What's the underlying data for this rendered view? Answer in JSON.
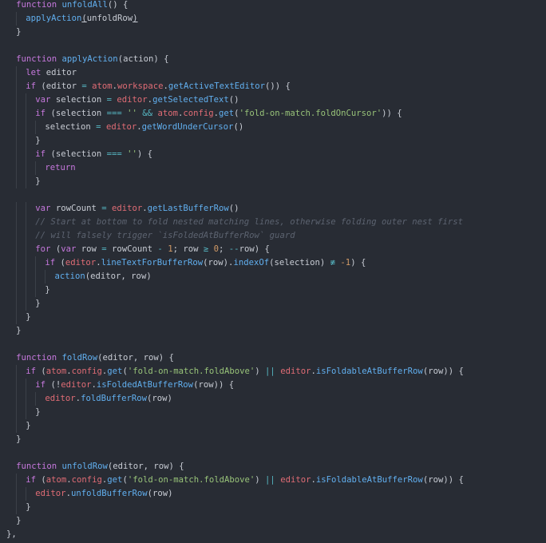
{
  "colors": {
    "background": "#282c34",
    "keyword": "#c678dd",
    "function": "#61afef",
    "object": "#e06c75",
    "string": "#98c379",
    "number": "#d19a66",
    "operator": "#56b6c2",
    "comment": "#5c6370",
    "plain": "#c8ccd4"
  },
  "lines": [
    {
      "indent": 1,
      "tokens": [
        {
          "t": "function",
          "c": "kw"
        },
        {
          "t": " ",
          "c": "pl"
        },
        {
          "t": "unfoldAll",
          "c": "fn"
        },
        {
          "t": "() {",
          "c": "pl"
        }
      ]
    },
    {
      "indent": 2,
      "tokens": [
        {
          "t": "applyAction",
          "c": "fn"
        },
        {
          "t": "(",
          "c": "pl cur"
        },
        {
          "t": "unfoldRow",
          "c": "pl"
        },
        {
          "t": ")",
          "c": "pl cur"
        }
      ]
    },
    {
      "indent": 1,
      "tokens": [
        {
          "t": "}",
          "c": "pl"
        }
      ]
    },
    {
      "indent": 0,
      "tokens": []
    },
    {
      "indent": 1,
      "tokens": [
        {
          "t": "function",
          "c": "kw"
        },
        {
          "t": " ",
          "c": "pl"
        },
        {
          "t": "applyAction",
          "c": "fn"
        },
        {
          "t": "(action) {",
          "c": "pl"
        }
      ]
    },
    {
      "indent": 2,
      "tokens": [
        {
          "t": "let",
          "c": "kw"
        },
        {
          "t": " editor",
          "c": "pl"
        }
      ]
    },
    {
      "indent": 2,
      "tokens": [
        {
          "t": "if",
          "c": "kw"
        },
        {
          "t": " (editor ",
          "c": "pl"
        },
        {
          "t": "=",
          "c": "op"
        },
        {
          "t": " ",
          "c": "pl"
        },
        {
          "t": "atom",
          "c": "obj"
        },
        {
          "t": ".",
          "c": "pl"
        },
        {
          "t": "workspace",
          "c": "obj"
        },
        {
          "t": ".",
          "c": "pl"
        },
        {
          "t": "getActiveTextEditor",
          "c": "fn"
        },
        {
          "t": "()) {",
          "c": "pl"
        }
      ]
    },
    {
      "indent": 3,
      "tokens": [
        {
          "t": "var",
          "c": "kw"
        },
        {
          "t": " selection ",
          "c": "pl"
        },
        {
          "t": "=",
          "c": "op"
        },
        {
          "t": " ",
          "c": "pl"
        },
        {
          "t": "editor",
          "c": "obj"
        },
        {
          "t": ".",
          "c": "pl"
        },
        {
          "t": "getSelectedText",
          "c": "fn"
        },
        {
          "t": "()",
          "c": "pl"
        }
      ]
    },
    {
      "indent": 3,
      "tokens": [
        {
          "t": "if",
          "c": "kw"
        },
        {
          "t": " (selection ",
          "c": "pl"
        },
        {
          "t": "===",
          "c": "op"
        },
        {
          "t": " ",
          "c": "pl"
        },
        {
          "t": "''",
          "c": "str"
        },
        {
          "t": " ",
          "c": "pl"
        },
        {
          "t": "&&",
          "c": "op"
        },
        {
          "t": " ",
          "c": "pl"
        },
        {
          "t": "atom",
          "c": "obj"
        },
        {
          "t": ".",
          "c": "pl"
        },
        {
          "t": "config",
          "c": "obj"
        },
        {
          "t": ".",
          "c": "pl"
        },
        {
          "t": "get",
          "c": "fn"
        },
        {
          "t": "(",
          "c": "pl"
        },
        {
          "t": "'fold-on-match.foldOnCursor'",
          "c": "str"
        },
        {
          "t": ")) {",
          "c": "pl"
        }
      ]
    },
    {
      "indent": 4,
      "tokens": [
        {
          "t": "selection ",
          "c": "pl"
        },
        {
          "t": "=",
          "c": "op"
        },
        {
          "t": " ",
          "c": "pl"
        },
        {
          "t": "editor",
          "c": "obj"
        },
        {
          "t": ".",
          "c": "pl"
        },
        {
          "t": "getWordUnderCursor",
          "c": "fn"
        },
        {
          "t": "()",
          "c": "pl"
        }
      ]
    },
    {
      "indent": 3,
      "tokens": [
        {
          "t": "}",
          "c": "pl"
        }
      ]
    },
    {
      "indent": 3,
      "tokens": [
        {
          "t": "if",
          "c": "kw"
        },
        {
          "t": " (selection ",
          "c": "pl"
        },
        {
          "t": "===",
          "c": "op"
        },
        {
          "t": " ",
          "c": "pl"
        },
        {
          "t": "''",
          "c": "str"
        },
        {
          "t": ") {",
          "c": "pl"
        }
      ]
    },
    {
      "indent": 4,
      "tokens": [
        {
          "t": "return",
          "c": "kw"
        }
      ]
    },
    {
      "indent": 3,
      "tokens": [
        {
          "t": "}",
          "c": "pl"
        }
      ]
    },
    {
      "indent": 0,
      "tokens": []
    },
    {
      "indent": 3,
      "tokens": [
        {
          "t": "var",
          "c": "kw"
        },
        {
          "t": " rowCount ",
          "c": "pl"
        },
        {
          "t": "=",
          "c": "op"
        },
        {
          "t": " ",
          "c": "pl"
        },
        {
          "t": "editor",
          "c": "obj"
        },
        {
          "t": ".",
          "c": "pl"
        },
        {
          "t": "getLastBufferRow",
          "c": "fn"
        },
        {
          "t": "()",
          "c": "pl"
        }
      ]
    },
    {
      "indent": 3,
      "tokens": [
        {
          "t": "// Start at bottom to fold nested matching lines, otherwise folding outer nest first",
          "c": "com"
        }
      ]
    },
    {
      "indent": 3,
      "tokens": [
        {
          "t": "// will falsely trigger `isFoldedAtBufferRow` guard",
          "c": "com"
        }
      ]
    },
    {
      "indent": 3,
      "tokens": [
        {
          "t": "for",
          "c": "kw"
        },
        {
          "t": " (",
          "c": "pl"
        },
        {
          "t": "var",
          "c": "kw"
        },
        {
          "t": " row ",
          "c": "pl"
        },
        {
          "t": "=",
          "c": "op"
        },
        {
          "t": " rowCount ",
          "c": "pl"
        },
        {
          "t": "-",
          "c": "op"
        },
        {
          "t": " ",
          "c": "pl"
        },
        {
          "t": "1",
          "c": "num"
        },
        {
          "t": "; row ",
          "c": "pl"
        },
        {
          "t": "≥",
          "c": "op"
        },
        {
          "t": " ",
          "c": "pl"
        },
        {
          "t": "0",
          "c": "num"
        },
        {
          "t": "; ",
          "c": "pl"
        },
        {
          "t": "--",
          "c": "op"
        },
        {
          "t": "row) {",
          "c": "pl"
        }
      ]
    },
    {
      "indent": 4,
      "tokens": [
        {
          "t": "if",
          "c": "kw"
        },
        {
          "t": " (",
          "c": "pl"
        },
        {
          "t": "editor",
          "c": "obj"
        },
        {
          "t": ".",
          "c": "pl"
        },
        {
          "t": "lineTextForBufferRow",
          "c": "fn"
        },
        {
          "t": "(row).",
          "c": "pl"
        },
        {
          "t": "indexOf",
          "c": "fn"
        },
        {
          "t": "(selection) ",
          "c": "pl"
        },
        {
          "t": "≢",
          "c": "op"
        },
        {
          "t": " ",
          "c": "pl"
        },
        {
          "t": "-1",
          "c": "num"
        },
        {
          "t": ") {",
          "c": "pl"
        }
      ]
    },
    {
      "indent": 5,
      "tokens": [
        {
          "t": "action",
          "c": "fn"
        },
        {
          "t": "(editor, row)",
          "c": "pl"
        }
      ]
    },
    {
      "indent": 4,
      "tokens": [
        {
          "t": "}",
          "c": "pl"
        }
      ]
    },
    {
      "indent": 3,
      "tokens": [
        {
          "t": "}",
          "c": "pl"
        }
      ]
    },
    {
      "indent": 2,
      "tokens": [
        {
          "t": "}",
          "c": "pl"
        }
      ]
    },
    {
      "indent": 1,
      "tokens": [
        {
          "t": "}",
          "c": "pl"
        }
      ]
    },
    {
      "indent": 0,
      "tokens": []
    },
    {
      "indent": 1,
      "tokens": [
        {
          "t": "function",
          "c": "kw"
        },
        {
          "t": " ",
          "c": "pl"
        },
        {
          "t": "foldRow",
          "c": "fn"
        },
        {
          "t": "(editor, row) {",
          "c": "pl"
        }
      ]
    },
    {
      "indent": 2,
      "tokens": [
        {
          "t": "if",
          "c": "kw"
        },
        {
          "t": " (",
          "c": "pl"
        },
        {
          "t": "atom",
          "c": "obj"
        },
        {
          "t": ".",
          "c": "pl"
        },
        {
          "t": "config",
          "c": "obj"
        },
        {
          "t": ".",
          "c": "pl"
        },
        {
          "t": "get",
          "c": "fn"
        },
        {
          "t": "(",
          "c": "pl"
        },
        {
          "t": "'fold-on-match.foldAbove'",
          "c": "str"
        },
        {
          "t": ") ",
          "c": "pl"
        },
        {
          "t": "||",
          "c": "op"
        },
        {
          "t": " ",
          "c": "pl"
        },
        {
          "t": "editor",
          "c": "obj"
        },
        {
          "t": ".",
          "c": "pl"
        },
        {
          "t": "isFoldableAtBufferRow",
          "c": "fn"
        },
        {
          "t": "(row)) {",
          "c": "pl"
        }
      ]
    },
    {
      "indent": 3,
      "tokens": [
        {
          "t": "if",
          "c": "kw"
        },
        {
          "t": " (!",
          "c": "pl"
        },
        {
          "t": "editor",
          "c": "obj"
        },
        {
          "t": ".",
          "c": "pl"
        },
        {
          "t": "isFoldedAtBufferRow",
          "c": "fn"
        },
        {
          "t": "(row)) {",
          "c": "pl"
        }
      ]
    },
    {
      "indent": 4,
      "tokens": [
        {
          "t": "editor",
          "c": "obj"
        },
        {
          "t": ".",
          "c": "pl"
        },
        {
          "t": "foldBufferRow",
          "c": "fn"
        },
        {
          "t": "(row)",
          "c": "pl"
        }
      ]
    },
    {
      "indent": 3,
      "tokens": [
        {
          "t": "}",
          "c": "pl"
        }
      ]
    },
    {
      "indent": 2,
      "tokens": [
        {
          "t": "}",
          "c": "pl"
        }
      ]
    },
    {
      "indent": 1,
      "tokens": [
        {
          "t": "}",
          "c": "pl"
        }
      ]
    },
    {
      "indent": 0,
      "tokens": []
    },
    {
      "indent": 1,
      "tokens": [
        {
          "t": "function",
          "c": "kw"
        },
        {
          "t": " ",
          "c": "pl"
        },
        {
          "t": "unfoldRow",
          "c": "fn"
        },
        {
          "t": "(editor, row) {",
          "c": "pl"
        }
      ]
    },
    {
      "indent": 2,
      "tokens": [
        {
          "t": "if",
          "c": "kw"
        },
        {
          "t": " (",
          "c": "pl"
        },
        {
          "t": "atom",
          "c": "obj"
        },
        {
          "t": ".",
          "c": "pl"
        },
        {
          "t": "config",
          "c": "obj"
        },
        {
          "t": ".",
          "c": "pl"
        },
        {
          "t": "get",
          "c": "fn"
        },
        {
          "t": "(",
          "c": "pl"
        },
        {
          "t": "'fold-on-match.foldAbove'",
          "c": "str"
        },
        {
          "t": ") ",
          "c": "pl"
        },
        {
          "t": "||",
          "c": "op"
        },
        {
          "t": " ",
          "c": "pl"
        },
        {
          "t": "editor",
          "c": "obj"
        },
        {
          "t": ".",
          "c": "pl"
        },
        {
          "t": "isFoldableAtBufferRow",
          "c": "fn"
        },
        {
          "t": "(row)) {",
          "c": "pl"
        }
      ]
    },
    {
      "indent": 3,
      "tokens": [
        {
          "t": "editor",
          "c": "obj"
        },
        {
          "t": ".",
          "c": "pl"
        },
        {
          "t": "unfoldBufferRow",
          "c": "fn"
        },
        {
          "t": "(row)",
          "c": "pl"
        }
      ]
    },
    {
      "indent": 2,
      "tokens": [
        {
          "t": "}",
          "c": "pl"
        }
      ]
    },
    {
      "indent": 1,
      "tokens": [
        {
          "t": "}",
          "c": "pl"
        }
      ]
    },
    {
      "indent": 0,
      "tokens": [
        {
          "t": "},",
          "c": "pl"
        }
      ]
    }
  ]
}
